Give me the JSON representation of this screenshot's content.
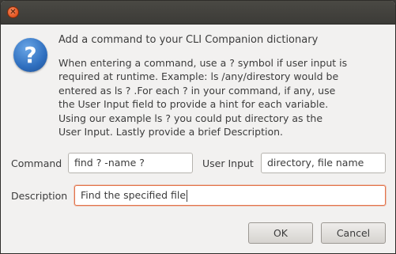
{
  "window": {
    "close_glyph": "✕"
  },
  "icon": {
    "name": "question-icon",
    "glyph": "?"
  },
  "header": {
    "title": "Add a command to your CLI Companion dictionary"
  },
  "instructions": {
    "lines": [
      "When entering a command, use a ? symbol if user input is",
      "required at runtime. Example: ls /any/direstory would be",
      "entered as ls ? .For each ? in your command, if any, use",
      "the User Input field to provide a hint for each variable.",
      "Using our example ls ? you could put directory as the",
      "User Input. Lastly provide a brief Description."
    ]
  },
  "form": {
    "command_label": "Command",
    "command_value": "find ? -name ?",
    "user_input_label": "User Input",
    "user_input_value": "directory, file name",
    "description_label": "Description",
    "description_value": "Find the specified file"
  },
  "buttons": {
    "ok_label": "OK",
    "cancel_label": "Cancel"
  },
  "colors": {
    "focus_accent": "#e3734a",
    "icon_blue": "#2f6fbf",
    "close_orange": "#e2531f"
  }
}
